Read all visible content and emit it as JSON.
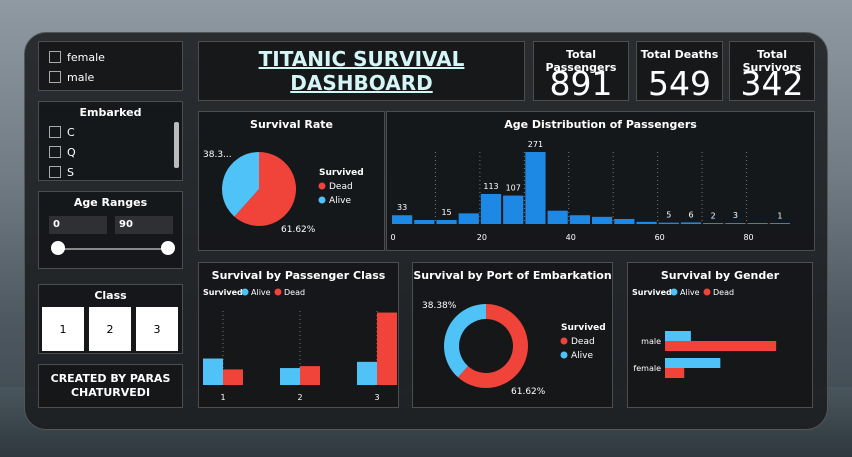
{
  "filters": {
    "sex_options": [
      "female",
      "male"
    ],
    "embarked_title": "Embarked",
    "embarked_options": [
      "C",
      "Q",
      "S"
    ],
    "age_title": "Age Ranges",
    "age_min": "0",
    "age_max": "90",
    "class_title": "Class",
    "class_options": [
      "1",
      "2",
      "3"
    ],
    "credit": "CREATED BY PARAS CHATURVEDI"
  },
  "header": {
    "title_line1": "TITANIC SURVIVAL",
    "title_line2": "DASHBOARD"
  },
  "kpis": [
    {
      "label": "Total Passengers",
      "value": "891"
    },
    {
      "label": "Total Deaths",
      "value": "549"
    },
    {
      "label": "Total Survivors",
      "value": "342"
    }
  ],
  "colors": {
    "dead": "#f0433a",
    "alive": "#4fc3f7",
    "bar": "#1e88e5"
  },
  "chart_data": [
    {
      "type": "pie",
      "title": "Survival Rate",
      "legend_title": "Survived",
      "labels": [
        "Dead",
        "Alive"
      ],
      "values": [
        61.62,
        38.38
      ],
      "data_labels": [
        "61.62%",
        "38.3..."
      ]
    },
    {
      "type": "bar",
      "title": "Age Distribution of Passengers",
      "x": [
        0,
        5,
        10,
        15,
        20,
        25,
        30,
        35,
        40,
        45,
        50,
        55,
        60,
        65,
        70,
        75,
        80,
        85
      ],
      "values": [
        33,
        15,
        15,
        40,
        113,
        107,
        271,
        50,
        33,
        27,
        19,
        8,
        5,
        6,
        2,
        3,
        0,
        1
      ],
      "data_labels": [
        "33",
        "",
        "15",
        "",
        "113",
        "107",
        "271",
        "",
        "",
        "",
        "",
        "",
        "5",
        "6",
        "2",
        "3",
        "",
        "1"
      ],
      "xticks": [
        "0",
        "20",
        "40",
        "60",
        "80"
      ],
      "xtick_values": [
        0,
        20,
        40,
        60,
        80
      ],
      "xlim": [
        0,
        90
      ]
    },
    {
      "type": "bar",
      "title": "Survival by Passenger Class",
      "legend_title": "Survived",
      "categories": [
        "1",
        "2",
        "3"
      ],
      "series": [
        {
          "name": "Alive",
          "values": [
            136,
            87,
            119
          ]
        },
        {
          "name": "Dead",
          "values": [
            80,
            97,
            372
          ]
        }
      ],
      "ylim": [
        0,
        380
      ]
    },
    {
      "type": "pie",
      "title": "Survival by Port of Embarkation",
      "legend_title": "Survived",
      "labels": [
        "Dead",
        "Alive"
      ],
      "values": [
        61.62,
        38.38
      ],
      "data_labels": [
        "61.62%",
        "38.38%"
      ]
    },
    {
      "type": "bar",
      "title": "Survival by Gender",
      "legend_title": "Survived",
      "orientation": "horizontal",
      "categories": [
        "male",
        "female"
      ],
      "series": [
        {
          "name": "Alive",
          "values": [
            109,
            233
          ]
        },
        {
          "name": "Dead",
          "values": [
            468,
            81
          ]
        }
      ],
      "xlim": [
        0,
        480
      ]
    }
  ]
}
